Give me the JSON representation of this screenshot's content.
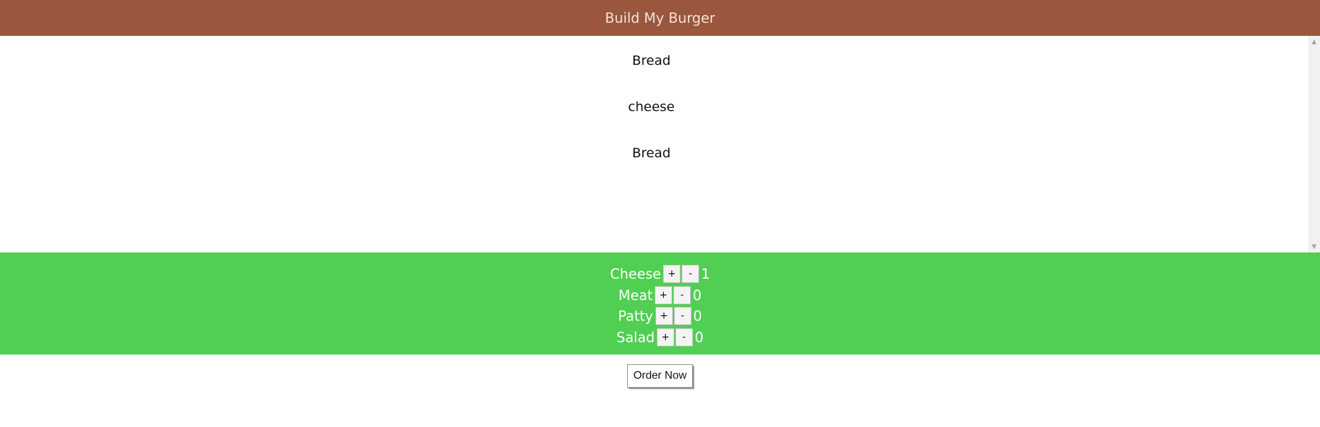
{
  "header": {
    "title": "Build My Burger"
  },
  "burger": {
    "ingredients": [
      "Bread",
      "cheese",
      "Bread"
    ]
  },
  "controls": [
    {
      "label": "Cheese",
      "plus": "+",
      "minus": "-",
      "count": "1"
    },
    {
      "label": "Meat",
      "plus": "+",
      "minus": "-",
      "count": "0"
    },
    {
      "label": "Patty",
      "plus": "+",
      "minus": "-",
      "count": "0"
    },
    {
      "label": "Salad",
      "plus": "+",
      "minus": "-",
      "count": "0"
    }
  ],
  "order": {
    "button_label": "Order Now"
  },
  "icons": {
    "scroll_up": "triangle-up-icon",
    "scroll_down": "triangle-down-icon"
  },
  "colors": {
    "header_bg": "#9a573d",
    "controls_bg": "#50cf52"
  }
}
